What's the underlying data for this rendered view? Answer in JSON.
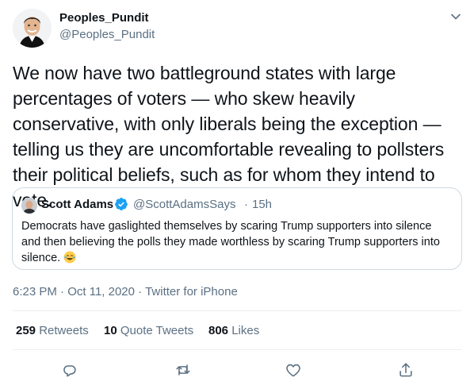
{
  "author": {
    "name": "Peoples_Pundit",
    "handle": "@Peoples_Pundit"
  },
  "tweet_text": "We now have two battleground states with large percentages of voters — who skew heavily conservative, with only liberals being the exception — telling us they are uncomfortable revealing to pollsters their political beliefs, such as for whom they intend to vote.",
  "quoted": {
    "name": "Scott Adams",
    "handle": "@ScottAdamsSays",
    "separator": "·",
    "time": "15h",
    "text": "Democrats have gaslighted themselves by scaring Trump supporters into silence and then believing the polls they made worthless by scaring Trump supporters into silence.",
    "emoji_icon": "face-with-tears-of-joy-icon"
  },
  "meta": {
    "time": "6:23 PM",
    "sep1": " · ",
    "date": "Oct 11, 2020",
    "sep2": " · ",
    "source": "Twitter for iPhone"
  },
  "stats": {
    "retweets_count": "259",
    "retweets_label": "Retweets",
    "quotes_count": "10",
    "quotes_label": "Quote Tweets",
    "likes_count": "806",
    "likes_label": "Likes"
  },
  "colors": {
    "text": "#0f1419",
    "secondary": "#5b7083",
    "verified": "#1da1f2",
    "border": "#cfd9de"
  }
}
